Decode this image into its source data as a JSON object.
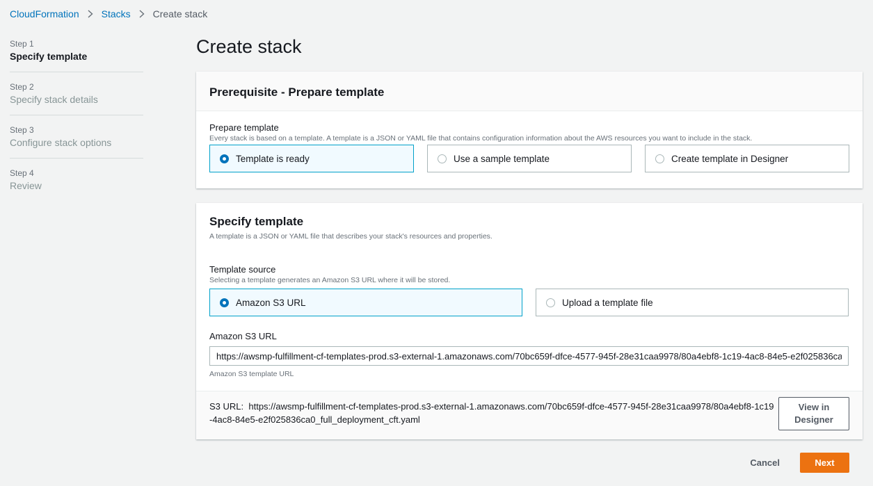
{
  "breadcrumb": {
    "items": [
      "CloudFormation",
      "Stacks"
    ],
    "current": "Create stack"
  },
  "steps": [
    {
      "num": "Step 1",
      "title": "Specify template"
    },
    {
      "num": "Step 2",
      "title": "Specify stack details"
    },
    {
      "num": "Step 3",
      "title": "Configure stack options"
    },
    {
      "num": "Step 4",
      "title": "Review"
    }
  ],
  "active_step": "Step 1",
  "page_title": "Create stack",
  "prerequisite": {
    "header": "Prerequisite - Prepare template",
    "label": "Prepare template",
    "description": "Every stack is based on a template. A template is a JSON or YAML file that contains configuration information about the AWS resources you want to include in the stack.",
    "options": [
      "Template is ready",
      "Use a sample template",
      "Create template in Designer"
    ],
    "selected": "Template is ready"
  },
  "specify": {
    "header": "Specify template",
    "description": "A template is a JSON or YAML file that describes your stack's resources and properties.",
    "source_label": "Template source",
    "source_description": "Selecting a template generates an Amazon S3 URL where it will be stored.",
    "source_options": [
      "Amazon S3 URL",
      "Upload a template file"
    ],
    "source_selected": "Amazon S3 URL",
    "url_label": "Amazon S3 URL",
    "url_value": "https://awsmp-fulfillment-cf-templates-prod.s3-external-1.amazonaws.com/70bc659f-dfce-4577-945f-28e31caa9978/80a4ebf8-1c19-4ac8-84e5-e2f025836ca0_full_deployment_cft.yaml",
    "url_hint": "Amazon S3 template URL",
    "s3_url_prefix": "S3 URL:",
    "s3_url_full": "https://awsmp-fulfillment-cf-templates-prod.s3-external-1.amazonaws.com/70bc659f-dfce-4577-945f-28e31caa9978/80a4ebf8-1c19-4ac8-84e5-e2f025836ca0_full_deployment_cft.yaml",
    "view_designer_line1": "View in",
    "view_designer_line2": "Designer"
  },
  "footer": {
    "cancel": "Cancel",
    "next": "Next"
  },
  "colors": {
    "link": "#0073bb",
    "primary_button": "#ec7211",
    "selected_border": "#00a1c9",
    "selected_bg": "#f1faff"
  }
}
